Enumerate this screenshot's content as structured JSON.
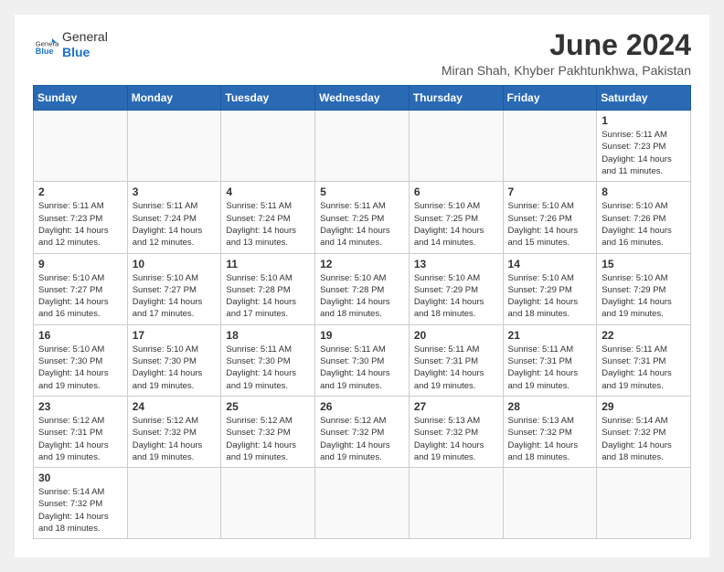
{
  "header": {
    "logo_general": "General",
    "logo_blue": "Blue",
    "title": "June 2024",
    "subtitle": "Miran Shah, Khyber Pakhtunkhwa, Pakistan"
  },
  "weekdays": [
    "Sunday",
    "Monday",
    "Tuesday",
    "Wednesday",
    "Thursday",
    "Friday",
    "Saturday"
  ],
  "weeks": [
    [
      {
        "day": "",
        "info": ""
      },
      {
        "day": "",
        "info": ""
      },
      {
        "day": "",
        "info": ""
      },
      {
        "day": "",
        "info": ""
      },
      {
        "day": "",
        "info": ""
      },
      {
        "day": "",
        "info": ""
      },
      {
        "day": "1",
        "info": "Sunrise: 5:11 AM\nSunset: 7:23 PM\nDaylight: 14 hours\nand 11 minutes."
      }
    ],
    [
      {
        "day": "2",
        "info": "Sunrise: 5:11 AM\nSunset: 7:23 PM\nDaylight: 14 hours\nand 12 minutes."
      },
      {
        "day": "3",
        "info": "Sunrise: 5:11 AM\nSunset: 7:24 PM\nDaylight: 14 hours\nand 12 minutes."
      },
      {
        "day": "4",
        "info": "Sunrise: 5:11 AM\nSunset: 7:24 PM\nDaylight: 14 hours\nand 13 minutes."
      },
      {
        "day": "5",
        "info": "Sunrise: 5:11 AM\nSunset: 7:25 PM\nDaylight: 14 hours\nand 14 minutes."
      },
      {
        "day": "6",
        "info": "Sunrise: 5:10 AM\nSunset: 7:25 PM\nDaylight: 14 hours\nand 14 minutes."
      },
      {
        "day": "7",
        "info": "Sunrise: 5:10 AM\nSunset: 7:26 PM\nDaylight: 14 hours\nand 15 minutes."
      },
      {
        "day": "8",
        "info": "Sunrise: 5:10 AM\nSunset: 7:26 PM\nDaylight: 14 hours\nand 16 minutes."
      }
    ],
    [
      {
        "day": "9",
        "info": "Sunrise: 5:10 AM\nSunset: 7:27 PM\nDaylight: 14 hours\nand 16 minutes."
      },
      {
        "day": "10",
        "info": "Sunrise: 5:10 AM\nSunset: 7:27 PM\nDaylight: 14 hours\nand 17 minutes."
      },
      {
        "day": "11",
        "info": "Sunrise: 5:10 AM\nSunset: 7:28 PM\nDaylight: 14 hours\nand 17 minutes."
      },
      {
        "day": "12",
        "info": "Sunrise: 5:10 AM\nSunset: 7:28 PM\nDaylight: 14 hours\nand 18 minutes."
      },
      {
        "day": "13",
        "info": "Sunrise: 5:10 AM\nSunset: 7:29 PM\nDaylight: 14 hours\nand 18 minutes."
      },
      {
        "day": "14",
        "info": "Sunrise: 5:10 AM\nSunset: 7:29 PM\nDaylight: 14 hours\nand 18 minutes."
      },
      {
        "day": "15",
        "info": "Sunrise: 5:10 AM\nSunset: 7:29 PM\nDaylight: 14 hours\nand 19 minutes."
      }
    ],
    [
      {
        "day": "16",
        "info": "Sunrise: 5:10 AM\nSunset: 7:30 PM\nDaylight: 14 hours\nand 19 minutes."
      },
      {
        "day": "17",
        "info": "Sunrise: 5:10 AM\nSunset: 7:30 PM\nDaylight: 14 hours\nand 19 minutes."
      },
      {
        "day": "18",
        "info": "Sunrise: 5:11 AM\nSunset: 7:30 PM\nDaylight: 14 hours\nand 19 minutes."
      },
      {
        "day": "19",
        "info": "Sunrise: 5:11 AM\nSunset: 7:30 PM\nDaylight: 14 hours\nand 19 minutes."
      },
      {
        "day": "20",
        "info": "Sunrise: 5:11 AM\nSunset: 7:31 PM\nDaylight: 14 hours\nand 19 minutes."
      },
      {
        "day": "21",
        "info": "Sunrise: 5:11 AM\nSunset: 7:31 PM\nDaylight: 14 hours\nand 19 minutes."
      },
      {
        "day": "22",
        "info": "Sunrise: 5:11 AM\nSunset: 7:31 PM\nDaylight: 14 hours\nand 19 minutes."
      }
    ],
    [
      {
        "day": "23",
        "info": "Sunrise: 5:12 AM\nSunset: 7:31 PM\nDaylight: 14 hours\nand 19 minutes."
      },
      {
        "day": "24",
        "info": "Sunrise: 5:12 AM\nSunset: 7:32 PM\nDaylight: 14 hours\nand 19 minutes."
      },
      {
        "day": "25",
        "info": "Sunrise: 5:12 AM\nSunset: 7:32 PM\nDaylight: 14 hours\nand 19 minutes."
      },
      {
        "day": "26",
        "info": "Sunrise: 5:12 AM\nSunset: 7:32 PM\nDaylight: 14 hours\nand 19 minutes."
      },
      {
        "day": "27",
        "info": "Sunrise: 5:13 AM\nSunset: 7:32 PM\nDaylight: 14 hours\nand 19 minutes."
      },
      {
        "day": "28",
        "info": "Sunrise: 5:13 AM\nSunset: 7:32 PM\nDaylight: 14 hours\nand 18 minutes."
      },
      {
        "day": "29",
        "info": "Sunrise: 5:14 AM\nSunset: 7:32 PM\nDaylight: 14 hours\nand 18 minutes."
      }
    ],
    [
      {
        "day": "30",
        "info": "Sunrise: 5:14 AM\nSunset: 7:32 PM\nDaylight: 14 hours\nand 18 minutes."
      },
      {
        "day": "",
        "info": ""
      },
      {
        "day": "",
        "info": ""
      },
      {
        "day": "",
        "info": ""
      },
      {
        "day": "",
        "info": ""
      },
      {
        "day": "",
        "info": ""
      },
      {
        "day": "",
        "info": ""
      }
    ]
  ]
}
